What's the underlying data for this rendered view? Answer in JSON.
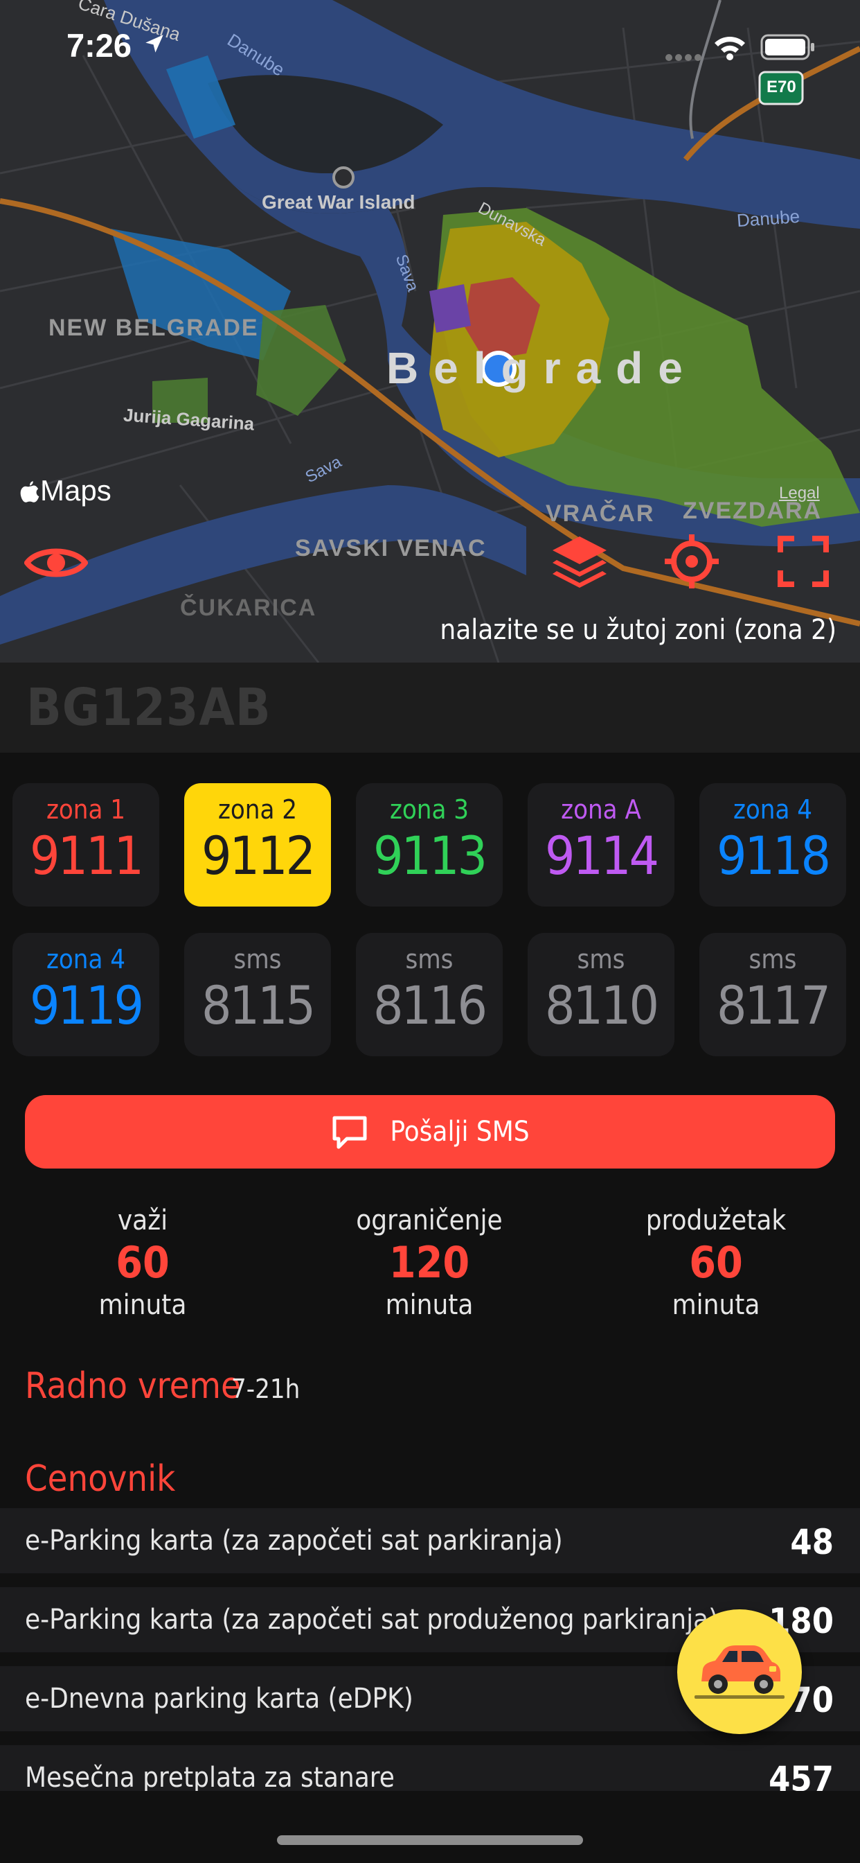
{
  "status_bar": {
    "time": "7:26"
  },
  "map": {
    "labels": {
      "cara_dusana": "Cara Dušana",
      "danube_top": "Danube",
      "danube_right": "Danube",
      "great_war_island": "Great War Island",
      "dunavska": "Dunavska",
      "sava_1": "Sava",
      "sava_2": "Sava",
      "new_belgrade": "NEW BELGRADE",
      "belgrade": "Belgrade",
      "jurija_gagarina": "Jurija Gagarina",
      "vracar": "VRAČAR",
      "zvezdara": "ZVEZDARA",
      "savski_venac": "SAVSKI VENAC",
      "cukarica": "ČUKARICA",
      "highway": "E70"
    },
    "maps_logo": "Maps",
    "legal": "Legal",
    "zone_info": "nalazite se u žutoj zoni (zona 2)",
    "icons": {
      "eye": "eye-icon",
      "layers": "layers-icon",
      "locate": "crosshair-icon",
      "expand": "expand-icon"
    }
  },
  "plate": "BG123AB",
  "zones": [
    {
      "label": "zona 1",
      "number": "9111",
      "color": "#ff453a",
      "selected": false
    },
    {
      "label": "zona 2",
      "number": "9112",
      "color": "#1c1c1e",
      "selected": true
    },
    {
      "label": "zona 3",
      "number": "9113",
      "color": "#30d158",
      "selected": false
    },
    {
      "label": "zona A",
      "number": "9114",
      "color": "#bf5af2",
      "selected": false
    },
    {
      "label": "zona 4",
      "number": "9118",
      "color": "#0a84ff",
      "selected": false
    },
    {
      "label": "zona 4",
      "number": "9119",
      "color": "#0a84ff",
      "selected": false
    },
    {
      "label": "sms",
      "number": "8115",
      "color": "#8e8e93",
      "selected": false
    },
    {
      "label": "sms",
      "number": "8116",
      "color": "#8e8e93",
      "selected": false
    },
    {
      "label": "sms",
      "number": "8110",
      "color": "#8e8e93",
      "selected": false
    },
    {
      "label": "sms",
      "number": "8117",
      "color": "#8e8e93",
      "selected": false
    }
  ],
  "selected_color": "#ffd60a",
  "sms_button": {
    "label": "Pošalji SMS",
    "icon": "message-icon"
  },
  "stats": [
    {
      "title": "važi",
      "value": "60",
      "unit": "minuta"
    },
    {
      "title": "ograničenje",
      "value": "120",
      "unit": "minuta"
    },
    {
      "title": "produžetak",
      "value": "60",
      "unit": "minuta"
    }
  ],
  "working_hours": {
    "title": "Radno vreme",
    "value": "7-21h"
  },
  "pricelist": {
    "title": "Cenovnik",
    "rows": [
      {
        "name": "e-Parking karta (za započeti sat parkiranja)",
        "price": "48"
      },
      {
        "name": "e-Parking karta (za započeti sat produženog parkiranja)",
        "price": "180"
      },
      {
        "name": "e-Dnevna parking karta (eDPK)",
        "price": "570"
      },
      {
        "name": "Mesečna pretplata za stanare",
        "price": "457"
      }
    ]
  },
  "fab_icon": "car-icon",
  "colors": {
    "accent": "#ff453a",
    "background": "#111111",
    "tile": "#1c1c1e",
    "fab": "#fde047"
  }
}
